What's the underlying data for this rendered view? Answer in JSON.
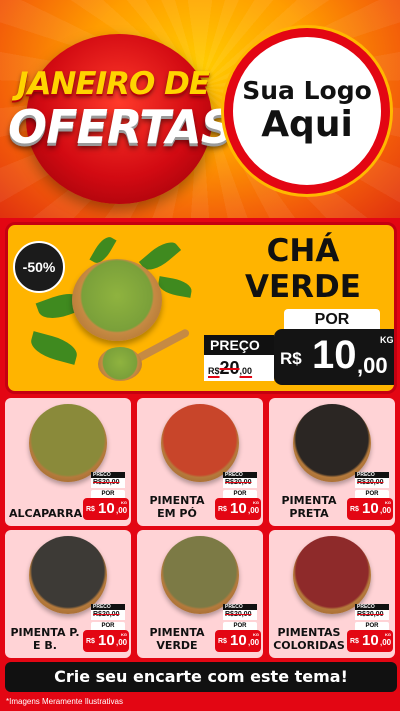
{
  "header": {
    "title_line1": "JANEIRO DE",
    "title_line2": "OFERTAS",
    "logo_line1": "Sua Logo",
    "logo_line2": "Aqui"
  },
  "featured": {
    "discount": "-50%",
    "name_line1": "CHÁ",
    "name_line2": "VERDE",
    "por_label": "POR",
    "preco_label": "PREÇO",
    "old_currency": "R$",
    "old_int": "20",
    "old_dec": ",00",
    "currency": "R$",
    "price_int": "10",
    "price_dec": ",00",
    "unit": "KG"
  },
  "products": [
    {
      "name": "ALCAPARRAS",
      "preco_label": "PRECO",
      "old_price": "R$20,00",
      "por_label": "POR",
      "currency": "R$",
      "price_int": "10",
      "price_dec": ",00",
      "unit": "KG",
      "color": "#8a8a3a"
    },
    {
      "name": "PIMENTA EM PÓ",
      "preco_label": "PRECO",
      "old_price": "R$20,00",
      "por_label": "POR",
      "currency": "R$",
      "price_int": "10",
      "price_dec": ",00",
      "unit": "KG",
      "color": "#c8452a"
    },
    {
      "name": "PIMENTA PRETA",
      "preco_label": "PRECO",
      "old_price": "R$20,00",
      "por_label": "POR",
      "currency": "R$",
      "price_int": "10",
      "price_dec": ",00",
      "unit": "KG",
      "color": "#2b2623"
    },
    {
      "name": "PIMENTA P. E B.",
      "preco_label": "PRECO",
      "old_price": "R$20,00",
      "por_label": "POR",
      "currency": "R$",
      "price_int": "10",
      "price_dec": ",00",
      "unit": "KG",
      "color": "#3d3a36"
    },
    {
      "name": "PIMENTA VERDE",
      "preco_label": "PRECO",
      "old_price": "R$20,00",
      "por_label": "POR",
      "currency": "R$",
      "price_int": "10",
      "price_dec": ",00",
      "unit": "KG",
      "color": "#7c7a45"
    },
    {
      "name": "PIMENTAS COLORIDAS",
      "preco_label": "PRECO",
      "old_price": "R$20,00",
      "por_label": "POR",
      "currency": "R$",
      "price_int": "10",
      "price_dec": ",00",
      "unit": "KG",
      "color": "#8e2a2a"
    }
  ],
  "cta": "Crie seu encarte com este tema!",
  "disclaimer": "*Imagens Meramente Ilustrativas",
  "colors": {
    "brand_red": "#e30613",
    "featured_yellow": "#ffb400",
    "card_pink": "#ffd3d6"
  }
}
